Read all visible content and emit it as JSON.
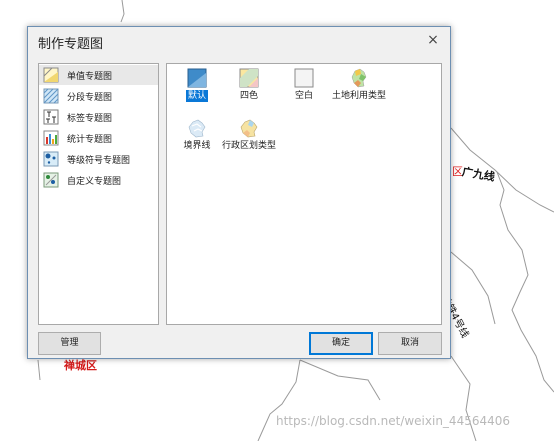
{
  "map": {
    "labels": {
      "guangjiu": "广九线",
      "district_fragment": "区",
      "metro": "地铁4号线",
      "chancheng": "禅城区",
      "watermark": "https://blog.csdn.net/weixin_44564406"
    }
  },
  "dialog": {
    "title": "制作专题图",
    "close_glyph": "×",
    "theme_types": [
      {
        "label": "单值专题图",
        "icon": "unique-value-icon",
        "selected": true
      },
      {
        "label": "分段专题图",
        "icon": "range-icon",
        "selected": false
      },
      {
        "label": "标签专题图",
        "icon": "label-icon",
        "selected": false
      },
      {
        "label": "统计专题图",
        "icon": "graph-icon",
        "selected": false
      },
      {
        "label": "等级符号专题图",
        "icon": "graduated-symbol-icon",
        "selected": false
      },
      {
        "label": "自定义专题图",
        "icon": "custom-icon",
        "selected": false
      }
    ],
    "templates": [
      {
        "label": "默认",
        "icon": "default-style-icon",
        "selected": true
      },
      {
        "label": "四色",
        "icon": "four-color-icon",
        "selected": false
      },
      {
        "label": "空白",
        "icon": "blank-icon",
        "selected": false
      },
      {
        "label": "土地利用类型",
        "icon": "land-use-icon",
        "selected": false
      },
      {
        "label": "境界线",
        "icon": "boundary-line-icon",
        "selected": false
      },
      {
        "label": "行政区划类型",
        "icon": "admin-division-icon",
        "selected": false
      }
    ],
    "buttons": {
      "manage": "管理",
      "ok": "确定",
      "cancel": "取消"
    }
  },
  "colors": {
    "selection": "#0a78d7",
    "dialog_bg": "#f0f0f0",
    "border": "#6d8fb2"
  }
}
